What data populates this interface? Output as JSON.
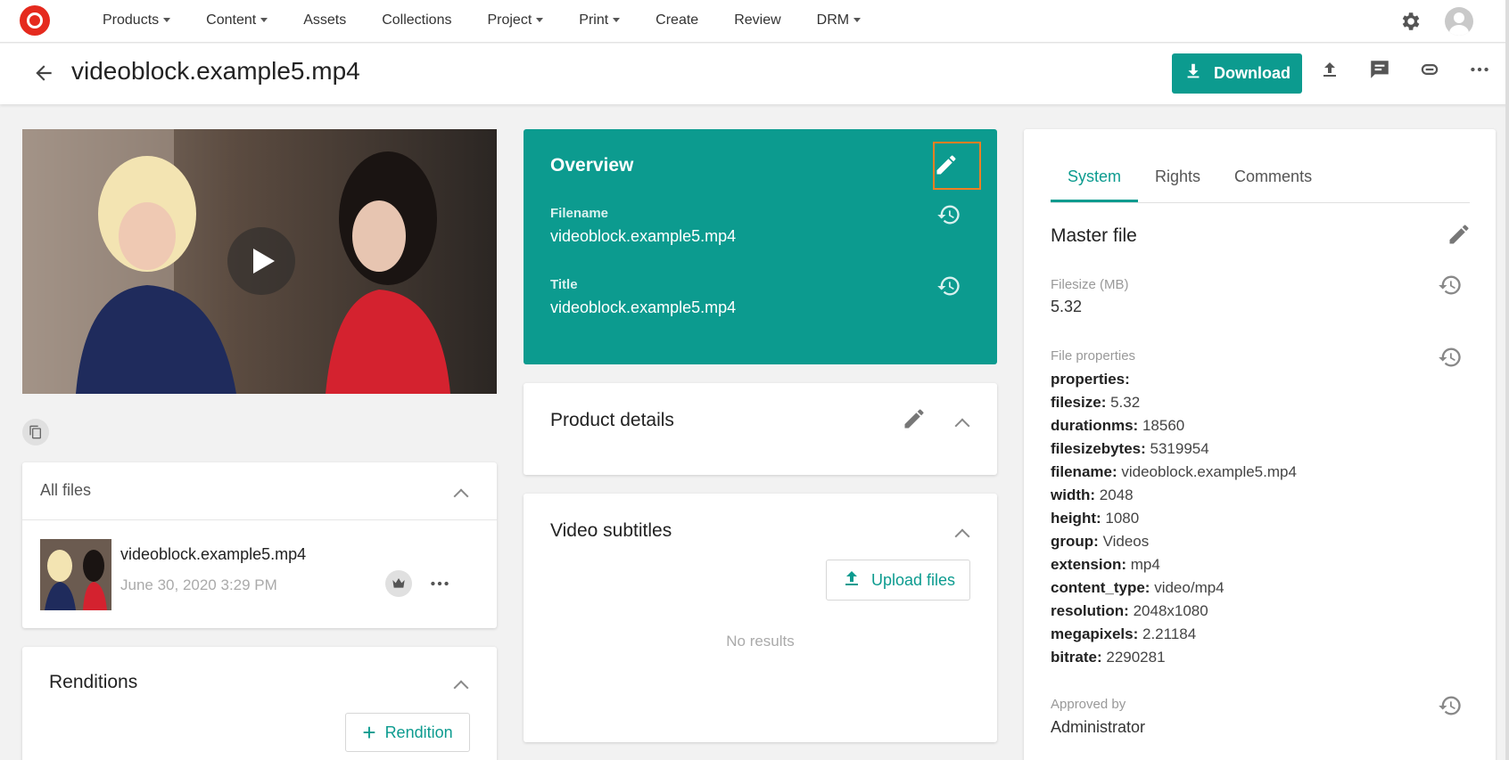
{
  "nav": {
    "items": [
      {
        "label": "Products",
        "dropdown": true
      },
      {
        "label": "Content",
        "dropdown": true
      },
      {
        "label": "Assets",
        "dropdown": false
      },
      {
        "label": "Collections",
        "dropdown": false
      },
      {
        "label": "Project",
        "dropdown": true
      },
      {
        "label": "Print",
        "dropdown": true
      },
      {
        "label": "Create",
        "dropdown": false
      },
      {
        "label": "Review",
        "dropdown": false
      },
      {
        "label": "DRM",
        "dropdown": true
      }
    ]
  },
  "header": {
    "title": "videoblock.example5.mp4",
    "download_label": "Download"
  },
  "all_files": {
    "title": "All files",
    "file_name": "videoblock.example5.mp4",
    "file_date": "June 30, 2020 3:29 PM"
  },
  "renditions": {
    "title": "Renditions",
    "add_label": "Rendition"
  },
  "overview": {
    "title": "Overview",
    "filename_label": "Filename",
    "filename_value": "videoblock.example5.mp4",
    "title_label": "Title",
    "title_value": "videoblock.example5.mp4"
  },
  "product_details": {
    "title": "Product details"
  },
  "video_subtitles": {
    "title": "Video subtitles",
    "upload_label": "Upload files",
    "empty_text": "No results"
  },
  "right_panel": {
    "tabs": [
      {
        "label": "System",
        "active": true
      },
      {
        "label": "Rights",
        "active": false
      },
      {
        "label": "Comments",
        "active": false
      }
    ],
    "master_file_title": "Master file",
    "filesize_label": "Filesize (MB)",
    "filesize_value": "5.32",
    "file_properties_label": "File properties",
    "properties_heading": "properties:",
    "properties": [
      {
        "key": "filesize:",
        "value": "5.32"
      },
      {
        "key": "durationms:",
        "value": "18560"
      },
      {
        "key": "filesizebytes:",
        "value": "5319954"
      },
      {
        "key": "filename:",
        "value": "videoblock.example5.mp4"
      },
      {
        "key": "width:",
        "value": "2048"
      },
      {
        "key": "height:",
        "value": "1080"
      },
      {
        "key": "group:",
        "value": "Videos"
      },
      {
        "key": "extension:",
        "value": "mp4"
      },
      {
        "key": "content_type:",
        "value": "video/mp4"
      },
      {
        "key": "resolution:",
        "value": "2048x1080"
      },
      {
        "key": "megapixels:",
        "value": "2.21184"
      },
      {
        "key": "bitrate:",
        "value": "2290281"
      }
    ],
    "approved_by_label": "Approved by",
    "approved_by_value": "Administrator"
  },
  "colors": {
    "accent": "#0c9b8f",
    "highlight": "#f07f22",
    "brand": "#e52a1e"
  }
}
